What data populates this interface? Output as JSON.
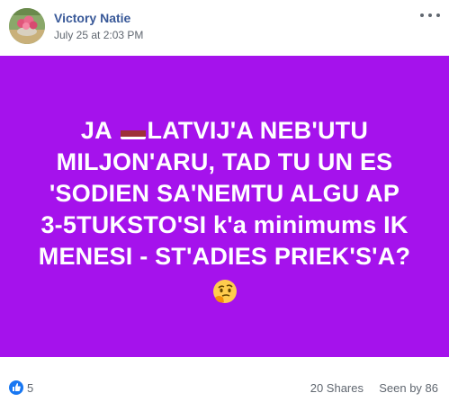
{
  "post": {
    "author": "Victory Natie",
    "timestamp": "July 25 at 2:03 PM",
    "avatar_icon": "flower-photo-avatar"
  },
  "card": {
    "background": "#a512ec",
    "text_color": "#ffffff",
    "line1_before_flag": "JA ",
    "line1_after_flag": "LATVIJ'A NEB'UTU",
    "line2": "MILJON'ARU, TAD TU UN ES",
    "line3": "'SODIEN SA'NEMTU ALGU AP",
    "line4": "3-5TUKSTO'SI k'a minimums IK",
    "line5": "MENESI - ST'ADIES PRIEK'S'A?",
    "flag_icon": "latvia-flag-icon",
    "emoji_icon": "thinking-face-icon"
  },
  "footer": {
    "likes": "5",
    "shares": "20 Shares",
    "seen": "Seen by 86",
    "like_color": "#1877f2"
  }
}
